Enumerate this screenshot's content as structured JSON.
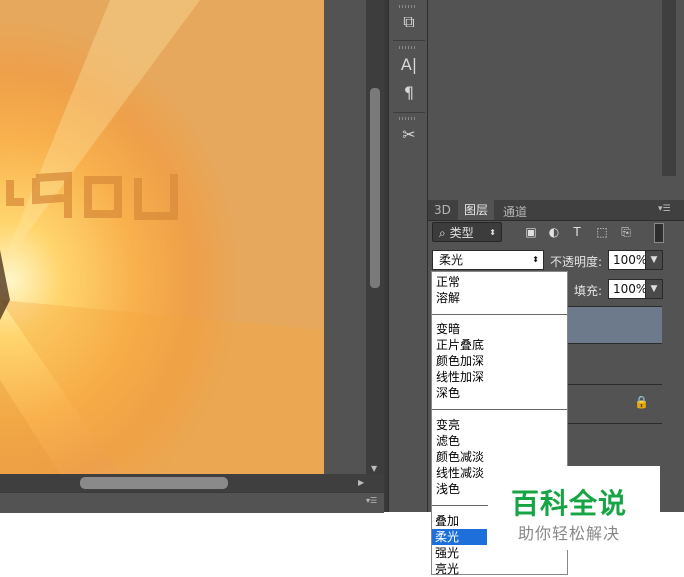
{
  "canvas": {
    "logo_text": "you"
  },
  "toolstrip": {
    "icons": [
      "stamp-stack-icon",
      "character-icon",
      "paragraph-icon",
      "tools-icon"
    ]
  },
  "layers_panel": {
    "tabs": [
      "3D",
      "图层",
      "通道"
    ],
    "active_tab": "图层",
    "filter_kind": "类型",
    "blend_mode": "柔光",
    "opacity_label": "不透明度:",
    "opacity_value": "100%",
    "fill_label": "填充:",
    "fill_value": "100%"
  },
  "blend_menu": {
    "groups": [
      [
        "正常",
        "溶解"
      ],
      [
        "变暗",
        "正片叠底",
        "颜色加深",
        "线性加深",
        "深色"
      ],
      [
        "变亮",
        "滤色",
        "颜色减淡",
        "线性减淡",
        "浅色"
      ],
      [
        "叠加",
        "柔光",
        "强光",
        "亮光"
      ]
    ],
    "selected": "柔光"
  },
  "watermark": {
    "line1": "百科全说",
    "line2": "助你轻松解决"
  },
  "colors": {
    "selection": "#1e6fd9",
    "watermark_green": "#16a444",
    "panel_bg": "#535353"
  }
}
